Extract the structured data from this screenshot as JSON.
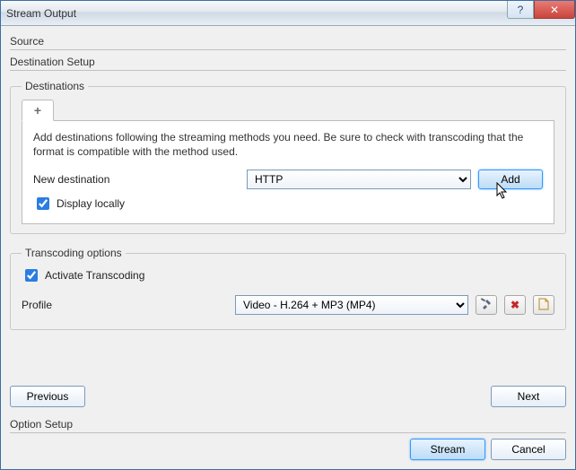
{
  "window": {
    "title": "Stream Output"
  },
  "sections": {
    "source": "Source",
    "destination_setup": "Destination Setup",
    "option_setup": "Option Setup"
  },
  "destinations": {
    "legend": "Destinations",
    "tab_add_icon": "+",
    "hint": "Add destinations following the streaming methods you need. Be sure to check with transcoding that the format is compatible with the method used.",
    "new_dest_label": "New destination",
    "protocol_selected": "HTTP",
    "add_label": "Add",
    "display_locally_label": "Display locally",
    "display_locally_checked": true
  },
  "transcoding": {
    "legend": "Transcoding options",
    "activate_label": "Activate Transcoding",
    "activate_checked": true,
    "profile_label": "Profile",
    "profile_selected": "Video - H.264 + MP3 (MP4)"
  },
  "nav": {
    "previous": "Previous",
    "next": "Next"
  },
  "footer": {
    "stream": "Stream",
    "cancel": "Cancel"
  }
}
